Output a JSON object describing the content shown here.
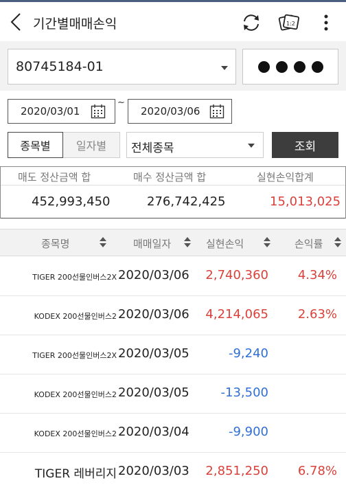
{
  "header": {
    "title": "기간별매매손익"
  },
  "account": {
    "number": "80745184-01",
    "password_mask": "●●●●"
  },
  "period": {
    "start": "2020/03/01",
    "separator": "~",
    "end": "2020/03/06"
  },
  "filters": {
    "by_stock_label": "종목별",
    "by_date_label": "일자별",
    "stock_select_value": "전체종목",
    "query_label": "조회"
  },
  "summary": {
    "headers": [
      "매도 정산금액 합",
      "매수 정산금액 합",
      "실현손익합계"
    ],
    "values": [
      "452,993,450",
      "276,742,425",
      "15,013,025"
    ]
  },
  "table": {
    "columns": [
      "종목명",
      "매매일자",
      "실현손익",
      "손익률"
    ],
    "rows": [
      {
        "name": "TIGER 200선물인버스2X",
        "date": "2020/03/06",
        "pl": "2,740,360",
        "rate": "4.34%",
        "pl_color": "red"
      },
      {
        "name": "KODEX 200선물인버스2",
        "date": "2020/03/06",
        "pl": "4,214,065",
        "rate": "2.63%",
        "pl_color": "red"
      },
      {
        "name": "TIGER 200선물인버스2X",
        "date": "2020/03/05",
        "pl": "-9,240",
        "rate": "",
        "pl_color": "blue"
      },
      {
        "name": "KODEX 200선물인버스2",
        "date": "2020/03/05",
        "pl": "-13,500",
        "rate": "",
        "pl_color": "blue"
      },
      {
        "name": "KODEX 200선물인버스2",
        "date": "2020/03/04",
        "pl": "-9,900",
        "rate": "",
        "pl_color": "blue"
      },
      {
        "name": "TIGER 레버리지",
        "date": "2020/03/03",
        "pl": "2,851,250",
        "rate": "6.78%",
        "pl_color": "red"
      }
    ]
  },
  "colors": {
    "positive": "#d9413a",
    "negative": "#2f6fd6",
    "button_dark": "#3d3d3d"
  },
  "icons": [
    "back-chevron-icon",
    "refresh-icon",
    "cards-icon",
    "more-vertical-icon",
    "calendar-icon",
    "dropdown-caret-icon",
    "sort-icon"
  ]
}
